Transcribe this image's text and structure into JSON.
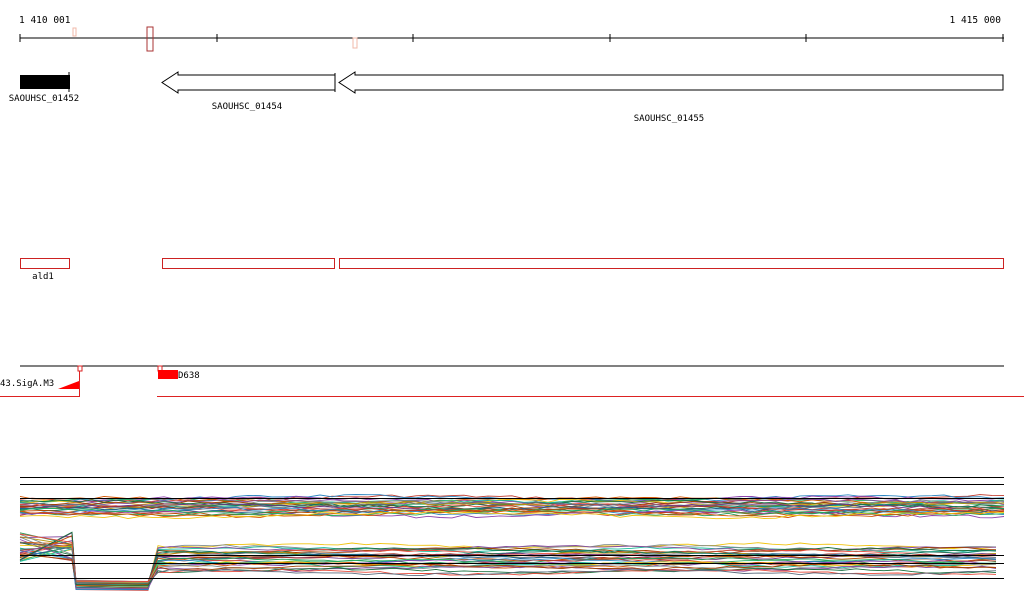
{
  "ruler": {
    "start_label": "1 410 001",
    "end_label": "1 415 000"
  },
  "genes": [
    {
      "id": "g1",
      "label": "SAOUHSC_01452",
      "strand": "filled"
    },
    {
      "id": "g2",
      "label": "SAOUHSC_01454",
      "strand": "minus"
    },
    {
      "id": "g3",
      "label": "SAOUHSC_01455",
      "strand": "minus"
    }
  ],
  "annotations": [
    {
      "id": "a1",
      "label": "ald1"
    },
    {
      "id": "a2",
      "label": ""
    },
    {
      "id": "a3",
      "label": ""
    }
  ],
  "features": {
    "left_label": "43.SigA.M3",
    "right_label": "D638"
  },
  "colors": {
    "gene_fill": "#000000",
    "outline_red": "#cc2222",
    "feature_red": "#ff0000",
    "axis": "#000000"
  },
  "expression_palette": [
    "#c0392b",
    "#2e86c1",
    "#8e44ad",
    "#27ae60",
    "#d35400",
    "#f1c40f",
    "#1abc9c",
    "#7f8c8d",
    "#884ea0",
    "#a04000",
    "#196f3d",
    "#e74c3c",
    "#5d6d7e",
    "#b7950b",
    "#117a65",
    "#6c3483",
    "#a93226",
    "#1f618d",
    "#ba4a00",
    "#239b56"
  ]
}
